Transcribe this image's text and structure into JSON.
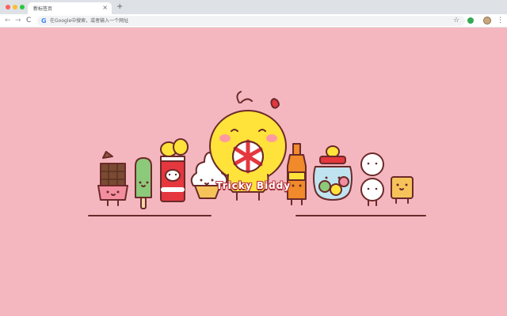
{
  "tab": {
    "title": "新标签页",
    "close_glyph": "×"
  },
  "new_tab_glyph": "+",
  "nav": {
    "back": "←",
    "forward": "→",
    "reload": "C"
  },
  "omnibox": {
    "google_glyph": "G",
    "placeholder": "在Google中搜索，或者输入一个网址"
  },
  "toolbar_icons": {
    "star": "☆",
    "menu": "⋮"
  },
  "brand": {
    "text": "Tricky Biddy"
  },
  "colors": {
    "background": "#f5b7bf",
    "outline": "#6b2a2a",
    "chick": "#ffe33a",
    "accent": "#e4373e"
  }
}
